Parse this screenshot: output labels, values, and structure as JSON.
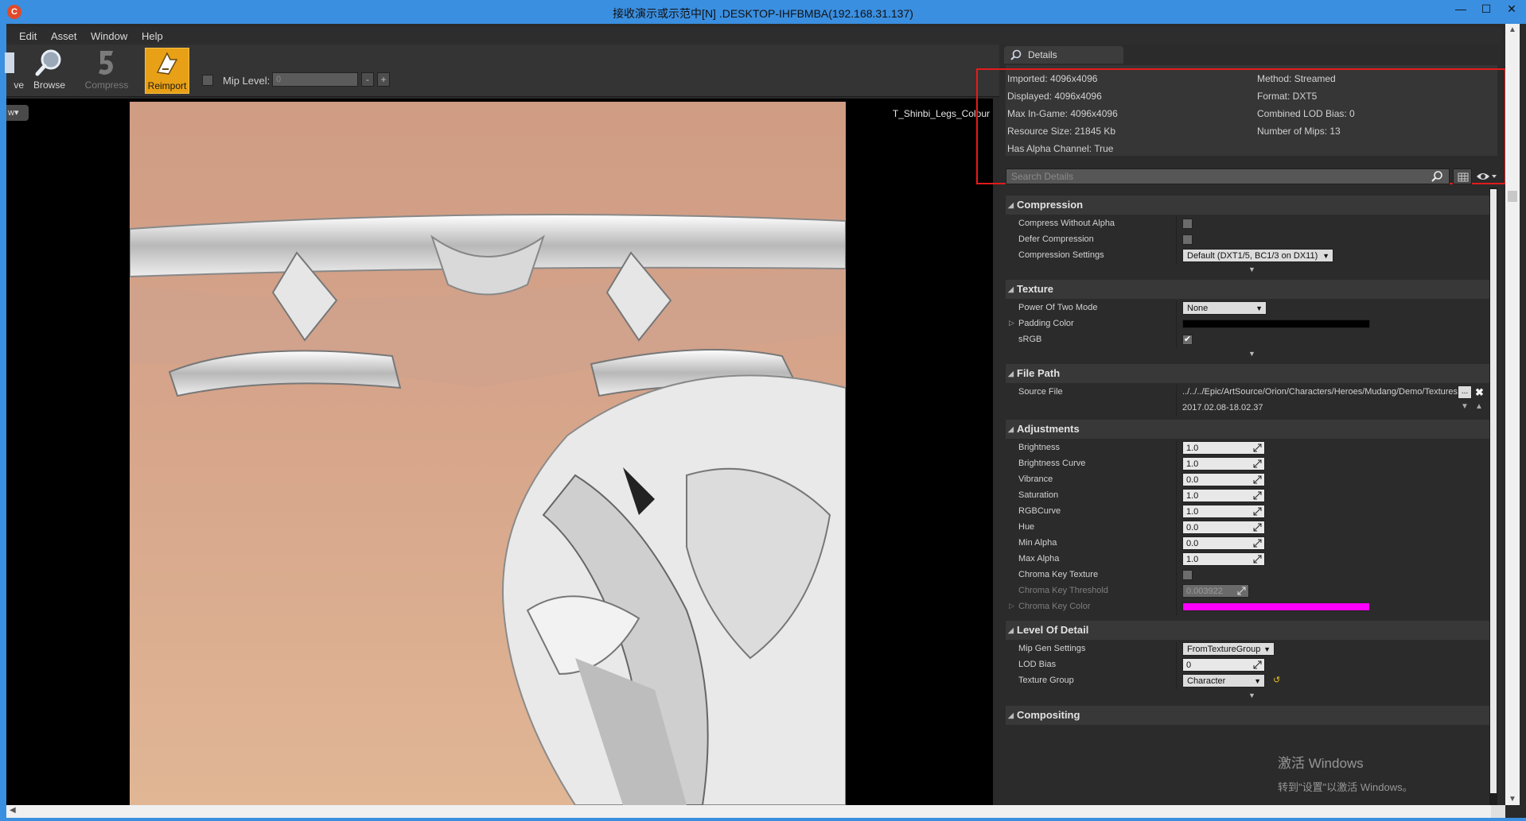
{
  "window": {
    "title": "接收演示或示范中[N] .DESKTOP-IHFBMBA(192.168.31.137)",
    "minimize": "—",
    "maximize": "☐",
    "close": "✕"
  },
  "menu": [
    "Edit",
    "Asset",
    "Window",
    "Help"
  ],
  "toolbar": {
    "save_partial": "ve",
    "browse": "Browse",
    "compress": "Compress",
    "reimport": "Reimport",
    "mip_label": "Mip Level:",
    "mip_value": "0",
    "mip_minus": "-",
    "mip_plus": "+"
  },
  "viewport": {
    "view_dropdown": "w▾",
    "texture_name": "T_Shinbi_Legs_Colour"
  },
  "details": {
    "tab": "Details",
    "info": {
      "imported": "Imported: 4096x4096",
      "displayed": "Displayed: 4096x4096",
      "max_in_game": "Max In-Game: 4096x4096",
      "resource_size": "Resource Size: 21845 Kb",
      "has_alpha": "Has Alpha Channel: True",
      "method": "Method: Streamed",
      "format": "Format: DXT5",
      "lod_bias": "Combined LOD Bias: 0",
      "num_mips": "Number of Mips: 13"
    },
    "search_placeholder": "Search Details",
    "categories": {
      "compression": "Compression",
      "texture": "Texture",
      "file_path": "File Path",
      "adjustments": "Adjustments",
      "lod": "Level Of Detail",
      "compositing": "Compositing"
    },
    "compression": {
      "compress_without_alpha": "Compress Without Alpha",
      "defer_compression": "Defer Compression",
      "compression_settings": "Compression Settings",
      "compression_settings_value": "Default (DXT1/5, BC1/3 on DX11)"
    },
    "texture": {
      "power_of_two": "Power Of Two Mode",
      "power_of_two_value": "None",
      "padding_color": "Padding Color",
      "padding_color_hex": "#000000",
      "srgb": "sRGB",
      "srgb_check": "✔"
    },
    "file_path": {
      "source_file": "Source File",
      "source_value": "../../../Epic/ArtSource/Orion/Characters/Heroes/Mudang/Demo/Textures",
      "browse_btn": "...",
      "clear_btn": "✖",
      "timestamp": "2017.02.08-18.02.37"
    },
    "adjustments": [
      {
        "label": "Brightness",
        "value": "1.0"
      },
      {
        "label": "Brightness Curve",
        "value": "1.0"
      },
      {
        "label": "Vibrance",
        "value": "0.0"
      },
      {
        "label": "Saturation",
        "value": "1.0"
      },
      {
        "label": "RGBCurve",
        "value": "1.0"
      },
      {
        "label": "Hue",
        "value": "0.0"
      },
      {
        "label": "Min Alpha",
        "value": "0.0"
      },
      {
        "label": "Max Alpha",
        "value": "1.0"
      }
    ],
    "chroma": {
      "texture": "Chroma Key Texture",
      "threshold": "Chroma Key Threshold",
      "threshold_value": "0.003922",
      "color": "Chroma Key Color",
      "color_hex": "#ff00ff"
    },
    "lod": {
      "mip_gen": "Mip Gen Settings",
      "mip_gen_value": "FromTextureGroup",
      "lod_bias": "LOD Bias",
      "lod_bias_value": "0",
      "texture_group": "Texture Group",
      "texture_group_value": "Character"
    }
  },
  "watermark": {
    "line1": "激活 Windows",
    "line2": "转到\"设置\"以激活 Windows。"
  },
  "colors": {
    "titlebar": "#3a8fe0",
    "highlight_box": "#e41b1b",
    "reimport_active": "#e8a016",
    "panel_bg": "#2b2b2b"
  }
}
